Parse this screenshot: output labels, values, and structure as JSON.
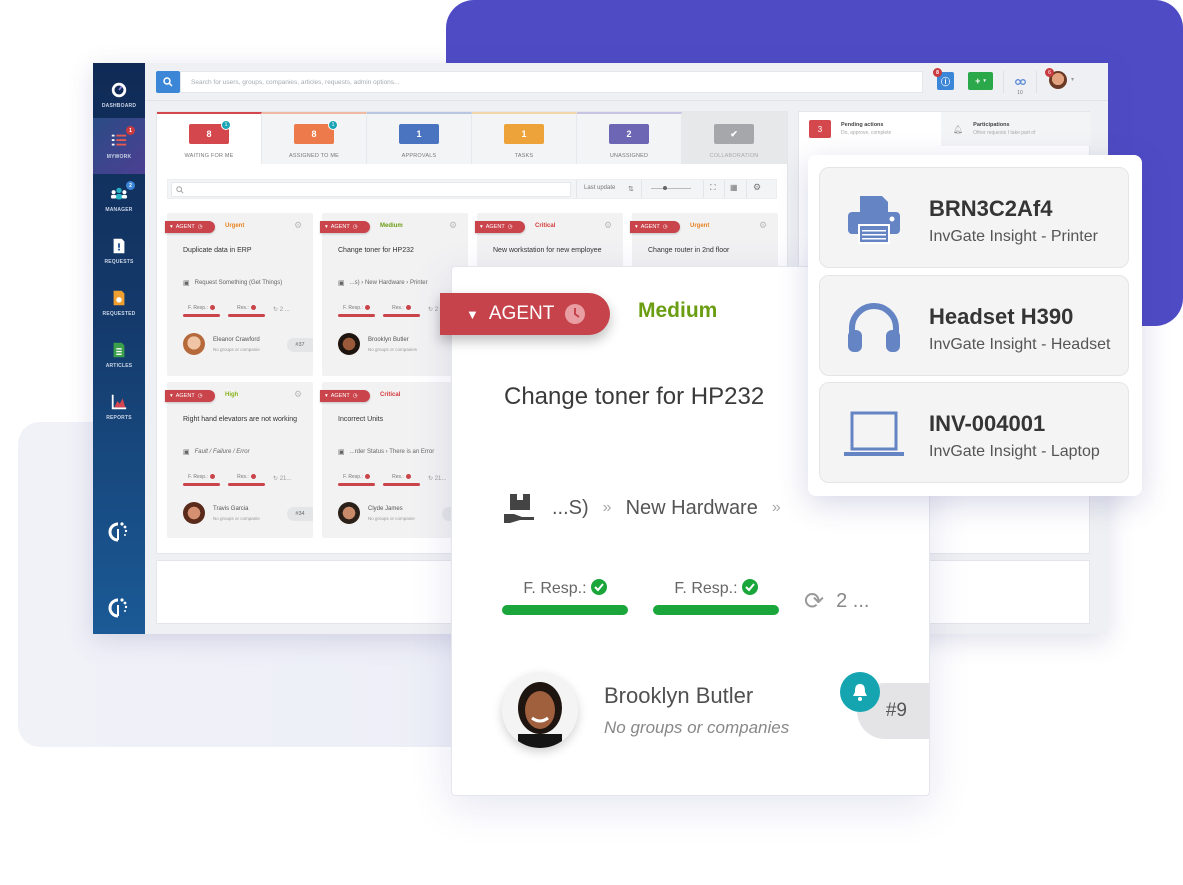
{
  "colors": {
    "brand_purple": "#4f4bc5",
    "agent_red": "#c6434b",
    "medium_green": "#6b9d12",
    "urgent_orange": "#e8821e",
    "critical_red": "#d63a3a",
    "high_yellowgreen": "#8ab41e",
    "sla_green": "#1aa63a",
    "teal": "#14a5b0"
  },
  "sidebar": {
    "items": [
      {
        "label": "DASHBOARD",
        "icon": "gauge-icon"
      },
      {
        "label": "MYWORK",
        "icon": "list-icon",
        "badge": "1",
        "active": true
      },
      {
        "label": "MANAGER",
        "icon": "users-icon",
        "badge": "2"
      },
      {
        "label": "REQUESTS",
        "icon": "request-doc-icon"
      },
      {
        "label": "REQUESTED",
        "icon": "requested-doc-icon"
      },
      {
        "label": "ARTICLES",
        "icon": "article-doc-icon"
      },
      {
        "label": "REPORTS",
        "icon": "chart-icon"
      }
    ],
    "logo": "invgate-logo"
  },
  "topbar": {
    "search_placeholder": "Search for users, groups, companies, articles, requests, admin options...",
    "notifications_badge": "8",
    "add_label": "+",
    "observers_count": "10",
    "user_badge": "6"
  },
  "tabs": [
    {
      "count": "8",
      "label": "WAITING FOR ME",
      "badge": "1",
      "color": "#d3474d",
      "active": true
    },
    {
      "count": "8",
      "label": "ASSIGNED TO ME",
      "badge": "1",
      "color": "#ec7a4a"
    },
    {
      "count": "1",
      "label": "APPROVALS",
      "color": "#4a73c0"
    },
    {
      "count": "1",
      "label": "TASKS",
      "color": "#eea23a"
    },
    {
      "count": "2",
      "label": "UNASSIGNED",
      "color": "#6d66b5"
    },
    {
      "count": "✔",
      "label": "COLLABORATION",
      "color": "#a5a7aa"
    }
  ],
  "filterbar": {
    "sort_label": "Last update"
  },
  "side_panel": {
    "pending": {
      "count": "3",
      "title": "Pending actions",
      "subtitle": "Do, approve, complete"
    },
    "participations": {
      "title": "Participations",
      "subtitle": "Other requests I take part of"
    }
  },
  "cards": [
    {
      "tag": "AGENT",
      "priority": "Urgent",
      "priority_color": "#e8821e",
      "title": "Duplicate data in ERP",
      "category": "Request Something (Get Things)",
      "sla1": "F. Resp.:",
      "sla2": "Res.:",
      "more": "2 ...",
      "person": "Eleanor Crawford",
      "person_sub": "No groups or companie",
      "id": "#37"
    },
    {
      "tag": "AGENT",
      "priority": "Medium",
      "priority_color": "#6b9d12",
      "title": "Change toner for HP232",
      "category": "...s)  ›  New Hardware  ›  Printer",
      "sla1": "F. Resp.:",
      "sla2": "Res.:",
      "more": "2",
      "person": "Brooklyn Butler",
      "person_sub": "No groups or companies",
      "id": ""
    },
    {
      "tag": "AGENT",
      "priority": "Critical",
      "priority_color": "#d63a3a",
      "title": "New workstation for new employee"
    },
    {
      "tag": "AGENT",
      "priority": "Urgent",
      "priority_color": "#e8821e",
      "title": "Change router in 2nd floor"
    },
    {
      "tag": "AGENT",
      "priority": "High",
      "priority_color": "#8ab41e",
      "title": "Right hand elevators are not working",
      "category": "Fault / Failure / Error",
      "sla1": "F. Resp.:",
      "sla2": "Res.:",
      "more": "21...",
      "person": "Travis Garcia",
      "person_sub": "No groups or companie",
      "id": "#34"
    },
    {
      "tag": "AGENT",
      "priority": "Critical",
      "priority_color": "#d63a3a",
      "title": "Incorrect Units",
      "category": "...rder Status  ›  There is an Error",
      "sla1": "F. Resp.:",
      "sla2": "Res.:",
      "more": "21...",
      "person": "Clyde James",
      "person_sub": "No groups or companie",
      "id": "#"
    }
  ],
  "big_card": {
    "tag": "AGENT",
    "priority": "Medium",
    "title": "Change toner for HP232",
    "category_prefix": "...S)",
    "category_main": "New Hardware",
    "chevron": "»",
    "sla1": "F. Resp.:",
    "sla2": "F. Resp.:",
    "more": "2 ...",
    "person": "Brooklyn Butler",
    "person_sub": "No groups or companies",
    "id": "#9"
  },
  "assets": [
    {
      "name": "BRN3C2Af4",
      "sub": "InvGate Insight - Printer",
      "icon": "printer-icon"
    },
    {
      "name": "Headset H390",
      "sub": "InvGate Insight - Headset",
      "icon": "headset-icon"
    },
    {
      "name": "INV-004001",
      "sub": "InvGate Insight - Laptop",
      "icon": "laptop-icon"
    }
  ]
}
